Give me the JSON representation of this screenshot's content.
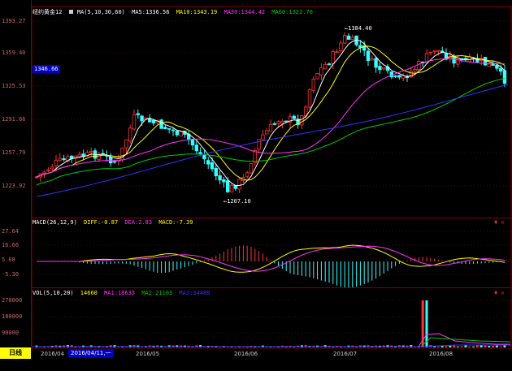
{
  "main": {
    "title": "纽约黄金12",
    "ma_label": "MA(5,10,30,60)",
    "ma5": "MA5:1336.56",
    "ma10": "MA10:1343.19",
    "ma30": "MA30:1344.42",
    "ma60": "MA60:1322.70",
    "y_ticks": [
      "1393.27",
      "1359.40",
      "1325.53",
      "1291.66",
      "1257.79",
      "1223.92"
    ],
    "current_price": "1346.66",
    "high_annotation": "1384.40",
    "low_annotation": "1207.10"
  },
  "macd": {
    "label": "MACD(26,12,9)",
    "diff": "DIFF:-0.87",
    "dea": "DEA:2.83",
    "macd": "MACD:-7.39",
    "y_ticks": [
      "27.64",
      "16.66",
      "5.68",
      "-5.30"
    ]
  },
  "vol": {
    "label": "VOL(5,10,20)",
    "value": "14660",
    "ma1": "MA1:18633",
    "ma2": "MA2:21103",
    "ma3": "MA3:34488",
    "y_ticks": [
      "270000",
      "180000",
      "90000"
    ]
  },
  "bottom": {
    "period": "日线",
    "date_box": "2016/04/11,一",
    "x_labels": [
      "2016/04",
      "2016/05",
      "2016/06",
      "2016/07",
      "2016/08"
    ]
  },
  "colors": {
    "up": "#ff3333",
    "down": "#33ffff",
    "ma5": "#ffffff",
    "ma10": "#ffff00",
    "ma30": "#ff33ff",
    "ma60": "#00cc00",
    "ma_long": "#3333ff"
  }
}
